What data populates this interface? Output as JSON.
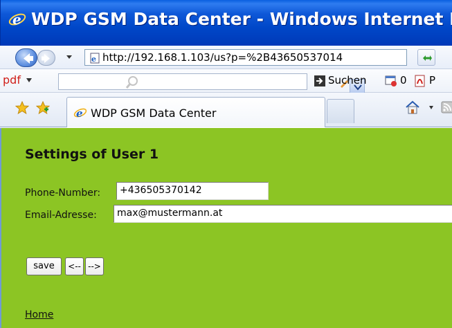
{
  "window": {
    "title": "WDP GSM Data Center - Windows Internet Ex"
  },
  "address_bar": {
    "url": "http://192.168.1.103/us?p=%2B43650537014"
  },
  "toolbar": {
    "pdf_label": "pdf",
    "search_value": "",
    "search_button_label": "Suchen",
    "counter_value": "0",
    "pdf_button_label": "P"
  },
  "tabs": [
    {
      "label": "WDP GSM Data Center",
      "active": true
    }
  ],
  "page": {
    "title": "Settings of User 1",
    "phone": {
      "label": "Phone-Number:",
      "value": "+436505370142"
    },
    "email": {
      "label": "Email-Adresse:",
      "value": "max@mustermann.at"
    },
    "buttons": {
      "save": "save",
      "prev": "<--",
      "next": "-->"
    },
    "home_link": "Home"
  },
  "colors": {
    "page_background": "#8cc524",
    "titlebar": "#0047c8",
    "pdf_brand": "#d0201a"
  },
  "icons": {
    "back": "back-arrow-icon",
    "forward": "forward-arrow-icon",
    "refresh": "refresh-icon",
    "search": "magnifier-icon",
    "favorites": "star-icon",
    "add_favorite": "add-favorite-icon",
    "home": "home-icon",
    "feeds": "feed-icon"
  }
}
